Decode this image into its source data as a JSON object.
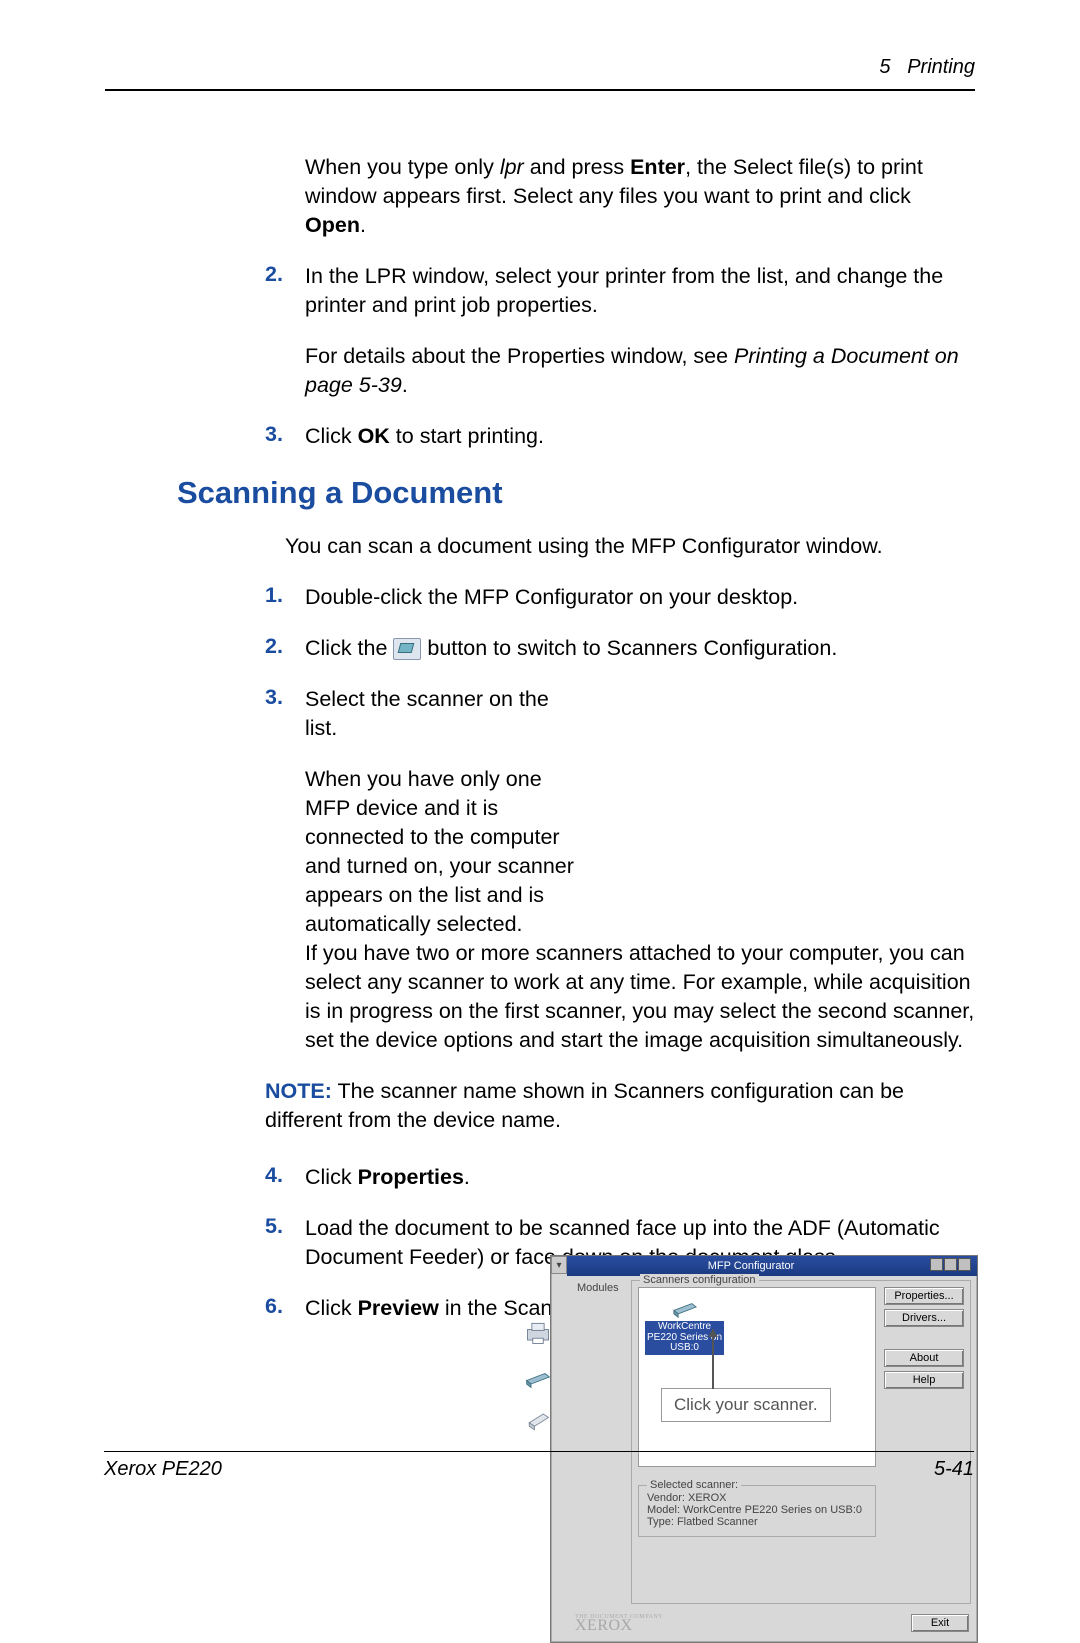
{
  "header": {
    "chapter_num": "5",
    "chapter_title": "Printing"
  },
  "intro_para": {
    "pre": "When you type only ",
    "italic": "lpr",
    "mid": " and press ",
    "bold1": "Enter",
    "after1": ", the Select file(s) to print window appears first.  Select any files you want to print and click ",
    "bold2": "Open",
    "end": "."
  },
  "steps_top": [
    {
      "num": "2.",
      "p1": "In the LPR window, select your printer from the list, and change the printer and print job properties.",
      "p2_pre": "For details about the Properties window, see ",
      "p2_italic": "Printing a Document on page  5-39",
      "p2_end": "."
    },
    {
      "num": "3.",
      "p1_pre": "Click ",
      "p1_bold": "OK",
      "p1_end": " to start printing."
    }
  ],
  "section_heading": "Scanning a Document",
  "section_intro": "You can scan a document using the MFP Configurator window.",
  "scan_steps": {
    "s1": {
      "num": "1.",
      "text": "Double-click the MFP Configurator on your desktop."
    },
    "s2": {
      "num": "2.",
      "pre": "Click the ",
      "post": " button to switch to Scanners Configuration."
    },
    "s3": {
      "num": "3.",
      "p1": "Select the scanner on the list.",
      "p2": "When you have only one MFP device and it is connected to the computer and turned on, your scanner appears on the list and is automatically selected.",
      "p3": "If you have two or more scanners attached to your computer, you can select any scanner to work at any time. For example, while acquisition is in progress on the first scanner, you may select the second scanner, set the device options and start the image acquisition simultaneously."
    },
    "s4": {
      "num": "4.",
      "pre": "Click ",
      "bold": "Properties",
      "end": "."
    },
    "s5": {
      "num": "5.",
      "text": "Load the document to be scanned face up into the ADF (Automatic Document Feeder) or face down on the document glass."
    },
    "s6": {
      "num": "6.",
      "pre": "Click ",
      "bold": "Preview",
      "end": " in the Scanner Properties window."
    }
  },
  "note": {
    "label": "NOTE:",
    "text": " The scanner name shown in Scanners configuration can be different from the device name."
  },
  "configurator": {
    "title": "MFP Configurator",
    "modules_label": "Modules",
    "frame_label": "Scanners configuration",
    "scanner_item": {
      "line1": "WorkCentre",
      "line2": "PE220 Series on",
      "line3": "USB:0"
    },
    "callout": "Click your scanner.",
    "selected_legend": "Selected scanner:",
    "vendor": "Vendor: XEROX",
    "model": "Model: WorkCentre PE220 Series on USB:0",
    "type": "Type: Flatbed Scanner",
    "buttons": {
      "properties": "Properties...",
      "drivers": "Drivers...",
      "about": "About",
      "help": "Help"
    },
    "footer_logo_tiny": "THE DOCUMENT COMPANY",
    "footer_logo": "XEROX",
    "exit": "Exit"
  },
  "footer": {
    "left": "Xerox PE220",
    "right": "5-41"
  }
}
